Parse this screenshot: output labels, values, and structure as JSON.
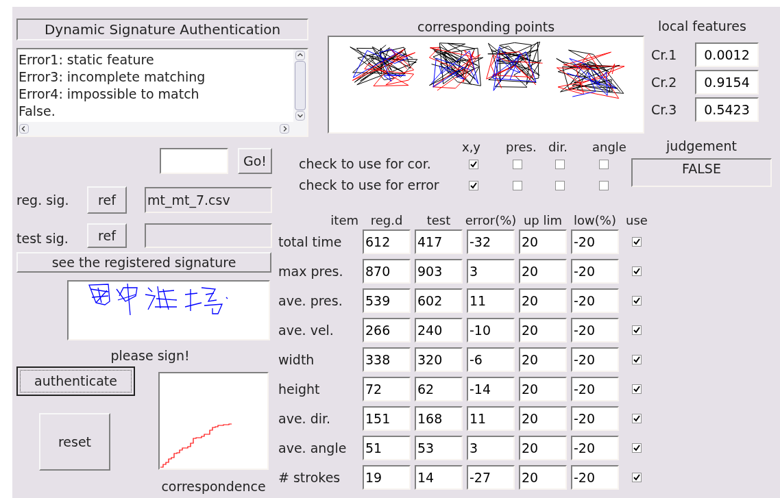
{
  "title": "Dynamic Signature Authentication",
  "messages": [
    "Error1: static feature",
    "Error3: incomplete matching",
    "Error4: impossible to match",
    "False."
  ],
  "go_button": "Go!",
  "reg_sig": {
    "label": "reg. sig.",
    "button": "ref",
    "file": "mt_mt_7.csv"
  },
  "test_sig": {
    "label": "test sig.",
    "button": "ref"
  },
  "see_registered_button": "see the registered signature",
  "sign_prompt": "please sign!",
  "authenticate_button": "authenticate",
  "reset_button": "reset",
  "correspondence_label": "correspondence",
  "corresponding_points_label": "corresponding points",
  "local_features": {
    "title": "local features",
    "items": [
      {
        "label": "Cr.1",
        "value": "0.0012"
      },
      {
        "label": "Cr.2",
        "value": "0.9154"
      },
      {
        "label": "Cr.3",
        "value": "0.5423"
      }
    ]
  },
  "check_columns": [
    "x,y",
    "pres.",
    "dir.",
    "angle"
  ],
  "check_rows": [
    {
      "label": "check to use for cor.",
      "checks": [
        {
          "checked": true
        },
        {
          "checked": false
        },
        {
          "checked": false
        },
        {
          "checked": false
        }
      ]
    },
    {
      "label": "check to use for error",
      "checks": [
        {
          "checked": true
        },
        {
          "checked": false
        },
        {
          "checked": false
        },
        {
          "checked": false
        }
      ]
    }
  ],
  "judgement": {
    "label": "judgement",
    "value": "FALSE"
  },
  "table": {
    "columns": [
      "item",
      "reg.d",
      "test",
      "error(%)",
      "up lim",
      "low(%)",
      "use"
    ],
    "rows": [
      {
        "item": "total time",
        "reg_d": "612",
        "test": "417",
        "error": "-32",
        "up_lim": "20",
        "low": "-20",
        "use": true
      },
      {
        "item": "max pres.",
        "reg_d": "870",
        "test": "903",
        "error": "3",
        "up_lim": "20",
        "low": "-20",
        "use": true
      },
      {
        "item": "ave. pres.",
        "reg_d": "539",
        "test": "602",
        "error": "11",
        "up_lim": "20",
        "low": "-20",
        "use": true
      },
      {
        "item": "ave. vel.",
        "reg_d": "266",
        "test": "240",
        "error": "-10",
        "up_lim": "20",
        "low": "-20",
        "use": true
      },
      {
        "item": "width",
        "reg_d": "338",
        "test": "320",
        "error": "-6",
        "up_lim": "20",
        "low": "-20",
        "use": true
      },
      {
        "item": "height",
        "reg_d": "72",
        "test": "62",
        "error": "-14",
        "up_lim": "20",
        "low": "-20",
        "use": true
      },
      {
        "item": "ave. dir.",
        "reg_d": "151",
        "test": "168",
        "error": "11",
        "up_lim": "20",
        "low": "-20",
        "use": true
      },
      {
        "item": "ave. angle",
        "reg_d": "51",
        "test": "53",
        "error": "3",
        "up_lim": "20",
        "low": "-20",
        "use": true
      },
      {
        "item": "# strokes",
        "reg_d": "19",
        "test": "14",
        "error": "-27",
        "up_lim": "20",
        "low": "-20",
        "use": true
      }
    ]
  }
}
